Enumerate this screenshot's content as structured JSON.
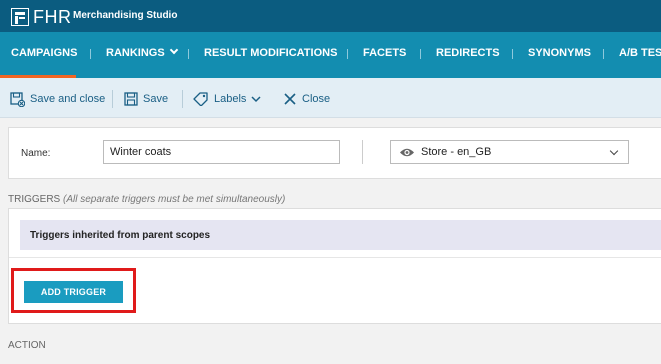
{
  "app": {
    "brand": "FHR",
    "title": "Merchandising Studio"
  },
  "nav": {
    "items": [
      {
        "label": "CAMPAIGNS",
        "active": true
      },
      {
        "label": "RANKINGS",
        "has_dropdown": true
      },
      {
        "label": "RESULT MODIFICATIONS"
      },
      {
        "label": "FACETS"
      },
      {
        "label": "REDIRECTS"
      },
      {
        "label": "SYNONYMS"
      },
      {
        "label": "A/B TES"
      }
    ],
    "active_color": "#f26522"
  },
  "toolbar": {
    "save_close_label": "Save and close",
    "save_label": "Save",
    "labels_label": "Labels",
    "close_label": "Close"
  },
  "form": {
    "name_label": "Name:",
    "name_value": "Winter coats",
    "scope_value": "Store - en_GB"
  },
  "triggers": {
    "title": "TRIGGERS",
    "note": "(All separate triggers must be met simultaneously)",
    "inherited_label": "Triggers inherited from parent scopes",
    "add_button_label": "ADD TRIGGER"
  },
  "action": {
    "title": "ACTION"
  },
  "colors": {
    "topbar": "#0b5c80",
    "navbar": "#138db0",
    "button": "#1a9cc0",
    "highlight": "#e01a1a"
  }
}
